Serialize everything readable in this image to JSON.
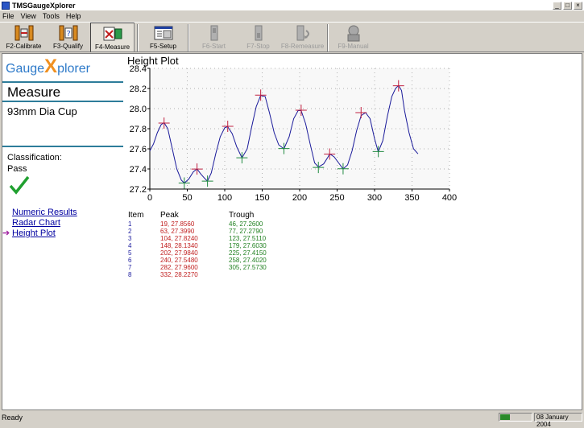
{
  "window": {
    "title": "TMSGaugeXplorer",
    "min": "_",
    "max": "□",
    "close": "×"
  },
  "menu": [
    "File",
    "View",
    "Tools",
    "Help"
  ],
  "toolbar": [
    {
      "label": "F2-Calibrate",
      "icon": "calibrate-icon",
      "enabled": true,
      "active": false
    },
    {
      "label": "F3-Qualify",
      "icon": "qualify-icon",
      "enabled": true,
      "active": false
    },
    {
      "label": "F4-Measure",
      "icon": "measure-icon",
      "enabled": true,
      "active": true
    },
    {
      "label": "F5-Setup",
      "icon": "setup-icon",
      "enabled": true,
      "active": false
    },
    {
      "label": "F6-Start",
      "icon": "start-icon",
      "enabled": false,
      "active": false
    },
    {
      "label": "F7-Stop",
      "icon": "stop-icon",
      "enabled": false,
      "active": false
    },
    {
      "label": "F8-Remeasure",
      "icon": "remeasure-icon",
      "enabled": false,
      "active": false
    },
    {
      "label": "F9-Manual",
      "icon": "manual-icon",
      "enabled": false,
      "active": false
    }
  ],
  "sidebar": {
    "logo_a": "Gauge",
    "logo_x": "X",
    "logo_b": "plorer",
    "section_title": "Measure",
    "part_name": "93mm Dia Cup",
    "classification_label": "Classification:",
    "classification_value": "Pass",
    "links": [
      {
        "label": "Numeric Results",
        "current": false
      },
      {
        "label": "Radar Chart",
        "current": false
      },
      {
        "label": "Height Plot",
        "current": true
      }
    ],
    "current_arrow": "➔"
  },
  "plot": {
    "title": "Height Plot",
    "chart_data": {
      "type": "line",
      "xlim": [
        0,
        400
      ],
      "ylim": [
        27.2,
        28.4
      ],
      "x_ticks": [
        0,
        50,
        100,
        150,
        200,
        250,
        300,
        350,
        400
      ],
      "y_ticks": [
        27.2,
        27.4,
        27.6,
        27.8,
        28.0,
        28.2,
        28.4
      ],
      "grid": "dotted",
      "line_color": "#1a1a9a",
      "peak_color": "#c02040",
      "trough_color": "#208a40",
      "series": [
        {
          "x": [
            0,
            5,
            10,
            15,
            19,
            24,
            30,
            36,
            42,
            46,
            52,
            58,
            63,
            68,
            74,
            77,
            82,
            88,
            94,
            100,
            104,
            110,
            116,
            123,
            130,
            136,
            142,
            148,
            154,
            160,
            166,
            172,
            179,
            186,
            192,
            198,
            202,
            208,
            214,
            220,
            225,
            232,
            238,
            240,
            246,
            252,
            258,
            264,
            270,
            276,
            282,
            288,
            294,
            300,
            305,
            311,
            317,
            323,
            328,
            332,
            336,
            340,
            346,
            352,
            358
          ],
          "y": [
            27.58,
            27.65,
            27.76,
            27.84,
            27.86,
            27.8,
            27.6,
            27.4,
            27.29,
            27.26,
            27.3,
            27.37,
            27.4,
            27.35,
            27.3,
            27.28,
            27.36,
            27.55,
            27.72,
            27.81,
            27.82,
            27.75,
            27.62,
            27.51,
            27.6,
            27.82,
            28.02,
            28.13,
            28.12,
            27.95,
            27.76,
            27.64,
            27.6,
            27.72,
            27.9,
            27.98,
            27.98,
            27.85,
            27.65,
            27.46,
            27.42,
            27.45,
            27.52,
            27.55,
            27.52,
            27.46,
            27.4,
            27.44,
            27.58,
            27.78,
            27.93,
            27.96,
            27.9,
            27.7,
            27.57,
            27.68,
            27.92,
            28.12,
            28.2,
            28.23,
            28.18,
            27.98,
            27.76,
            27.6,
            27.55
          ]
        }
      ],
      "peaks": [
        [
          19,
          27.856
        ],
        [
          63,
          27.399
        ],
        [
          104,
          27.824
        ],
        [
          148,
          28.134
        ],
        [
          202,
          27.984
        ],
        [
          240,
          27.548
        ],
        [
          282,
          27.96
        ],
        [
          332,
          28.227
        ]
      ],
      "troughs": [
        [
          46,
          27.26
        ],
        [
          77,
          27.279
        ],
        [
          123,
          27.511
        ],
        [
          179,
          27.603
        ],
        [
          225,
          27.415
        ],
        [
          258,
          27.402
        ],
        [
          305,
          27.573
        ]
      ]
    },
    "results_headers": {
      "item": "Item",
      "peak": "Peak",
      "trough": "Trough"
    },
    "results": [
      {
        "item": "1",
        "peak": "19, 27.8560",
        "trough": "46, 27.2600"
      },
      {
        "item": "2",
        "peak": "63, 27.3990",
        "trough": "77, 27.2790"
      },
      {
        "item": "3",
        "peak": "104, 27.8240",
        "trough": "123, 27.5110"
      },
      {
        "item": "4",
        "peak": "148, 28.1340",
        "trough": "179, 27.6030"
      },
      {
        "item": "5",
        "peak": "202, 27.9840",
        "trough": "225, 27.4150"
      },
      {
        "item": "6",
        "peak": "240, 27.5480",
        "trough": "258, 27.4020"
      },
      {
        "item": "7",
        "peak": "282, 27.9600",
        "trough": "305, 27.5730"
      },
      {
        "item": "8",
        "peak": "332, 28.2270",
        "trough": ""
      }
    ]
  },
  "status": {
    "text": "Ready",
    "date": "08 January 2004"
  }
}
